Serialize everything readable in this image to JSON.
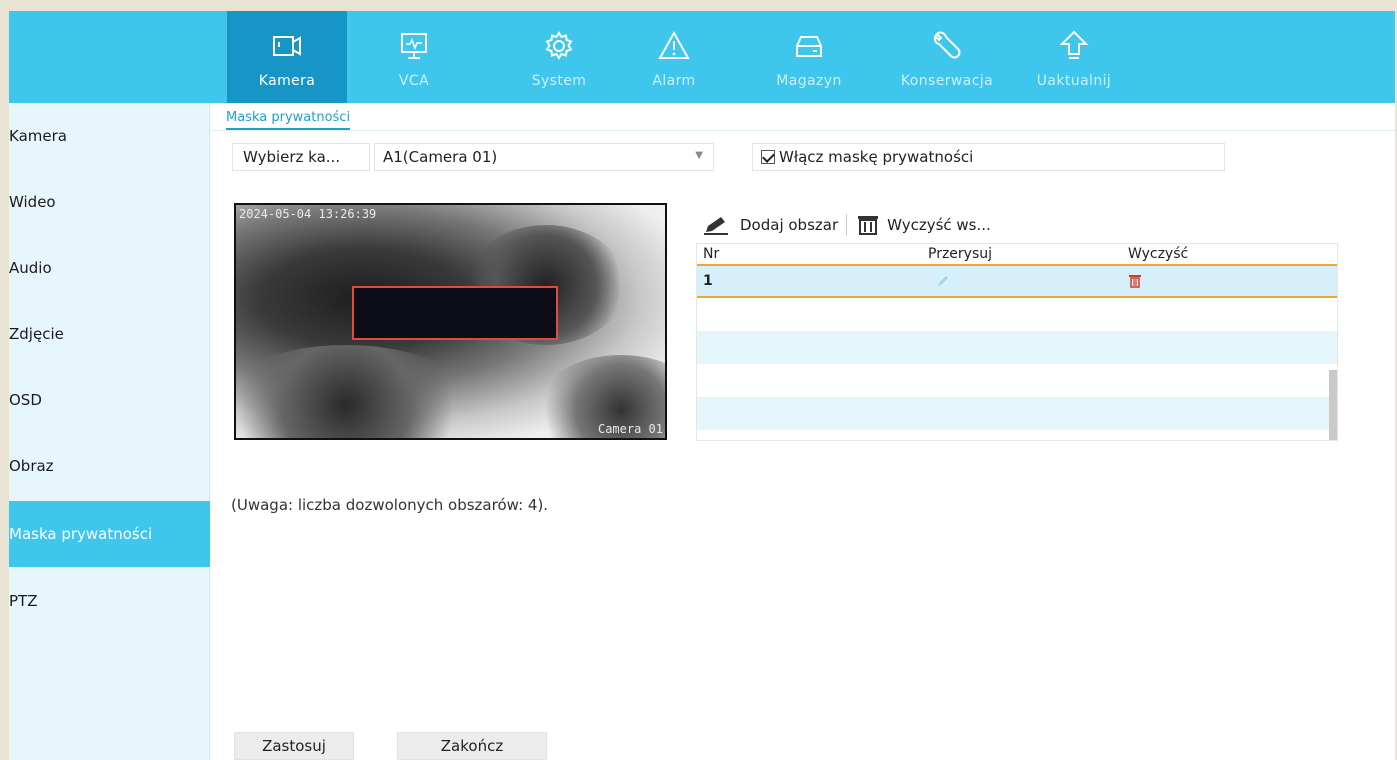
{
  "top_tabs": [
    {
      "label": "Kamera",
      "icon": "camera-icon"
    },
    {
      "label": "VCA",
      "icon": "monitor-icon"
    },
    {
      "label": "System",
      "icon": "gear-icon"
    },
    {
      "label": "Alarm",
      "icon": "warning-icon"
    },
    {
      "label": "Magazyn",
      "icon": "storage-icon"
    },
    {
      "label": "Konserwacja",
      "icon": "wrench-icon"
    },
    {
      "label": "Uaktualnij",
      "icon": "upgrade-arrow-icon"
    }
  ],
  "sidebar": {
    "items": [
      {
        "label": "Kamera"
      },
      {
        "label": "Wideo"
      },
      {
        "label": "Audio"
      },
      {
        "label": "Zdjęcie"
      },
      {
        "label": "OSD"
      },
      {
        "label": "Obraz"
      },
      {
        "label": "Maska prywatności"
      },
      {
        "label": "PTZ"
      }
    ],
    "active": "Maska prywatności"
  },
  "subtab": {
    "label": "Maska prywatności"
  },
  "camera_select": {
    "label": "Wybierz ka...",
    "value": "A1(Camera 01)"
  },
  "enable_mask": {
    "label": "Włącz maskę prywatności",
    "checked": true
  },
  "preview": {
    "timestamp": "2024-05-04 13:26:39",
    "camera_name": "Camera 01"
  },
  "toolbar": {
    "add_label": "Dodaj obszar",
    "clear_all_label": "Wyczyść ws..."
  },
  "table": {
    "headers": [
      "Nr",
      "Przerysuj",
      "Wyczyść"
    ],
    "rows": [
      {
        "nr": "1"
      }
    ]
  },
  "note": "(Uwaga: liczba dozwolonych obszarów: 4).",
  "buttons": {
    "apply": "Zastosuj",
    "exit": "Zakończ"
  },
  "colors": {
    "topbar": "#3ec6ed",
    "active_tab": "#1696c6",
    "accent_orange": "#f0a531",
    "mask_border": "#e24a3b"
  }
}
